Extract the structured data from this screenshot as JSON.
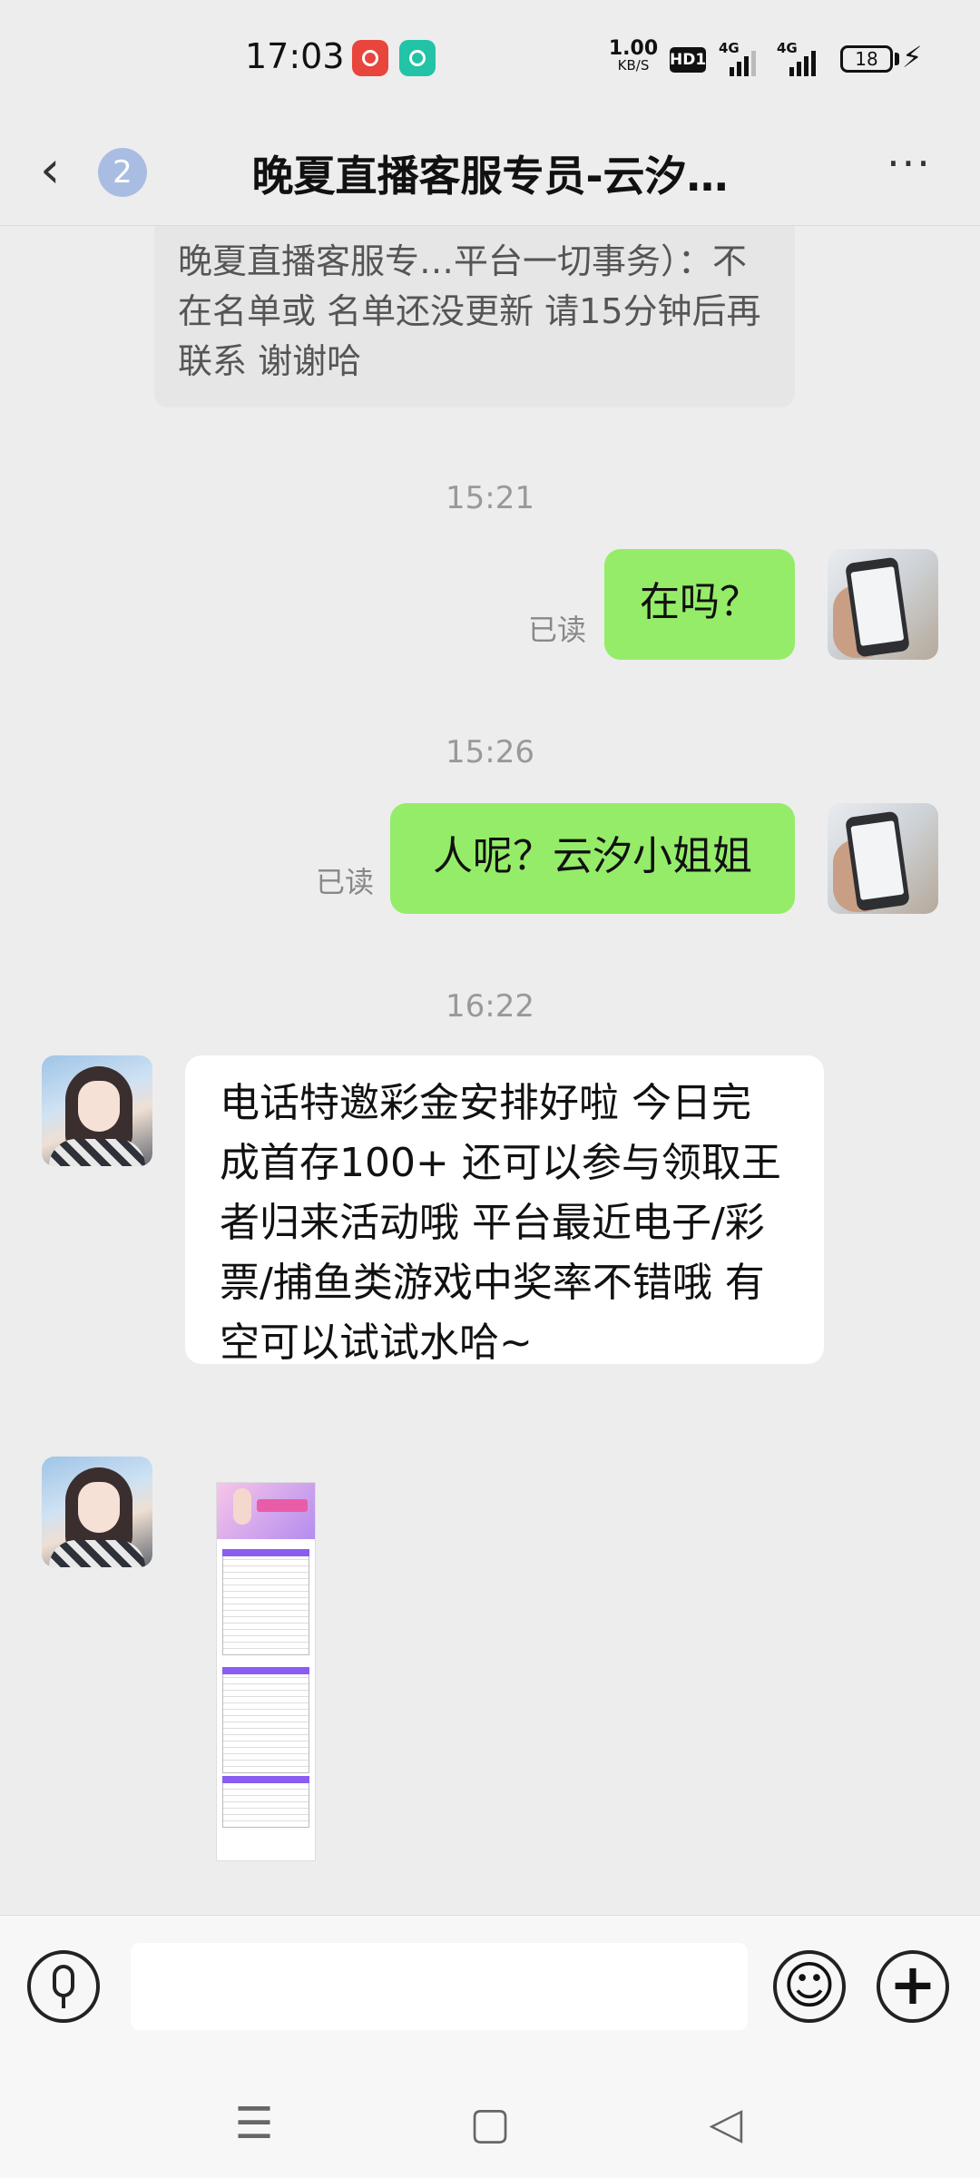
{
  "status_bar": {
    "time": "17:03",
    "net_speed_value": "1.00",
    "net_speed_unit": "KB/S",
    "hd_label": "HD1",
    "signal_1": "4G",
    "signal_2": "4G",
    "battery": "18",
    "app_icons": [
      "red-app-icon",
      "teal-chat-app-icon"
    ]
  },
  "header": {
    "unread_count": "2",
    "title": "晚夏直播客服专员-云汐…",
    "back_icon": "chevron-left-icon",
    "more_icon": "more-dots-icon"
  },
  "messages": {
    "system_notice": "晚夏直播客服专…平台一切事务）：不在名单或 名单还没更新 请15分钟后再联系 谢谢哈",
    "time_1": "15:21",
    "msg_1": "在吗？",
    "read_1": "已读",
    "time_2": "15:26",
    "msg_2": "人呢？云汐小姐姐",
    "read_2": "已读",
    "time_3": "16:22",
    "msg_3": "电话特邀彩金安排好啦   今日完成首存100+ 还可以参与领取王者归来活动哦 平台最近电子/彩票/捕鱼类游戏中奖率不错哦 有空可以试试水哈~"
  },
  "input_bar": {
    "text_value": "",
    "voice_icon": "microphone-icon",
    "emoji_icon": "emoji-icon",
    "plus_icon": "plus-icon"
  },
  "colors": {
    "sent_bubble": "#95ec69",
    "received_bubble": "#ffffff",
    "background": "#ededed",
    "badge": "#a9bde3"
  }
}
